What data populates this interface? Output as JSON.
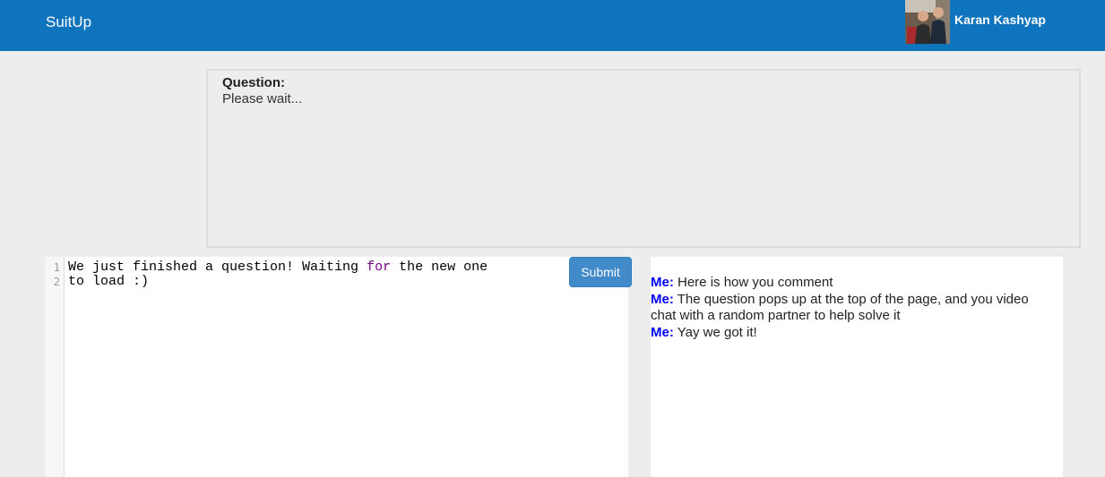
{
  "navbar": {
    "brand": "SuitUp",
    "user_name": "Karan Kashyap"
  },
  "question": {
    "label": "Question:",
    "text": "Please wait..."
  },
  "editor": {
    "line_numbers": [
      "1",
      "2"
    ],
    "line1_a": "We just finished a question! Waiting ",
    "line1_keyword": "for",
    "line1_b": " the new one",
    "line2": "to load :)",
    "submit_label": "Submit"
  },
  "chat": {
    "messages": [
      {
        "sender": "Me:",
        "text": " Here is how you comment"
      },
      {
        "sender": "Me:",
        "text": " The question pops up at the top of the page, and you video chat with a random partner to help solve it"
      },
      {
        "sender": "Me:",
        "text": " Yay we got it!"
      }
    ]
  },
  "colors": {
    "navbar": "#0e74be",
    "submit": "#428bca",
    "sender": "#0000ff",
    "keyword": "#770088"
  }
}
